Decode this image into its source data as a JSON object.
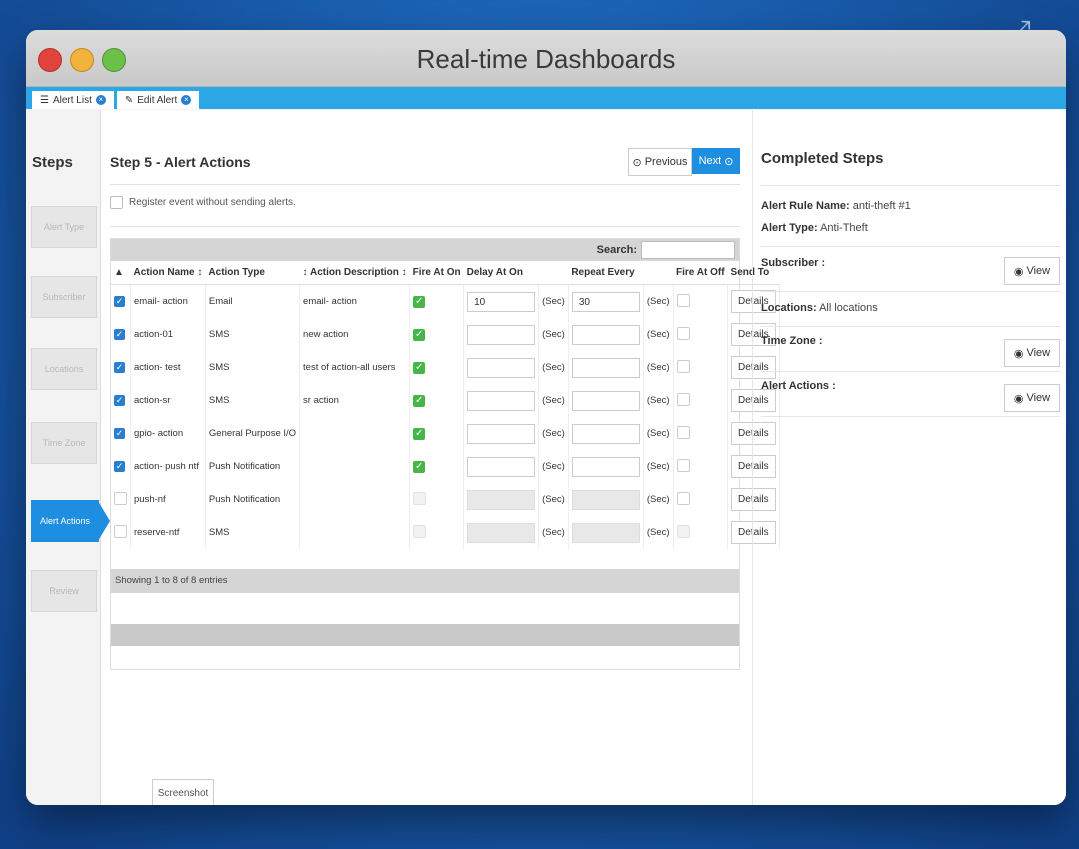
{
  "window": {
    "title": "Real-time Dashboards"
  },
  "tabs": [
    {
      "label": "Alert List"
    },
    {
      "label": "Edit Alert"
    }
  ],
  "steps": {
    "title": "Steps",
    "items": [
      "Alert Type",
      "Subscriber",
      "Locations",
      "Time Zone",
      "Alert Actions",
      "Review"
    ],
    "active": "Alert Actions"
  },
  "main": {
    "heading": "Step 5 - Alert Actions",
    "previous_label": "Previous",
    "next_label": "Next",
    "register_label": "Register event without sending alerts.",
    "search_label": "Search:",
    "search_value": "",
    "columns": [
      "Action Name",
      "Action Type",
      "Action Description",
      "Fire At On",
      "Delay At On",
      "Repeat Every",
      "Fire At Off",
      "Send To"
    ],
    "sec_unit": "(Sec)",
    "details_label": "Details",
    "rows": [
      {
        "checked": true,
        "name": "email- action",
        "type": "Email",
        "desc": "email- action",
        "fire_on": "checked",
        "delay": "10",
        "repeat": "30",
        "fire_off": "empty",
        "enabled": true
      },
      {
        "checked": true,
        "name": "action-01",
        "type": "SMS",
        "desc": "new action",
        "fire_on": "checked",
        "delay": "",
        "repeat": "",
        "fire_off": "empty",
        "enabled": true
      },
      {
        "checked": true,
        "name": "action- test",
        "type": "SMS",
        "desc": "test of action-all users",
        "fire_on": "checked",
        "delay": "",
        "repeat": "",
        "fire_off": "empty",
        "enabled": true
      },
      {
        "checked": true,
        "name": "action-sr",
        "type": "SMS",
        "desc": "sr action",
        "fire_on": "checked",
        "delay": "",
        "repeat": "",
        "fire_off": "empty",
        "enabled": true
      },
      {
        "checked": true,
        "name": "gpio- action",
        "type": "General Purpose I/O",
        "desc": "",
        "fire_on": "checked",
        "delay": "",
        "repeat": "",
        "fire_off": "empty",
        "enabled": true
      },
      {
        "checked": true,
        "name": "action- push ntf",
        "type": "Push Notification",
        "desc": "",
        "fire_on": "checked",
        "delay": "",
        "repeat": "",
        "fire_off": "empty",
        "enabled": true
      },
      {
        "checked": false,
        "name": "push-nf",
        "type": "Push Notification",
        "desc": "",
        "fire_on": "disabled",
        "delay": "",
        "repeat": "",
        "fire_off": "empty",
        "enabled": false
      },
      {
        "checked": false,
        "name": "reserve-ntf",
        "type": "SMS",
        "desc": "",
        "fire_on": "disabled",
        "delay": "",
        "repeat": "",
        "fire_off": "disabled",
        "enabled": false
      }
    ],
    "showing_text": "Showing 1 to 8 of 8 entries"
  },
  "completed": {
    "title": "Completed Steps",
    "rule_name_label": "Alert Rule Name:",
    "rule_name_value": "anti-theft #1",
    "alert_type_label": "Alert Type:",
    "alert_type_value": "Anti-Theft",
    "subscriber_label": "Subscriber :",
    "locations_label": "Locations:",
    "locations_value": "All locations",
    "timezone_label": "Time Zone :",
    "alert_actions_label": "Alert Actions :",
    "view_label": "View"
  },
  "footer_tab": "Screenshot",
  "colors": {
    "accent": "#1e8fe0",
    "tabbar": "#2aa7e4",
    "check_green": "#46b648",
    "check_blue": "#2a7ed0"
  }
}
